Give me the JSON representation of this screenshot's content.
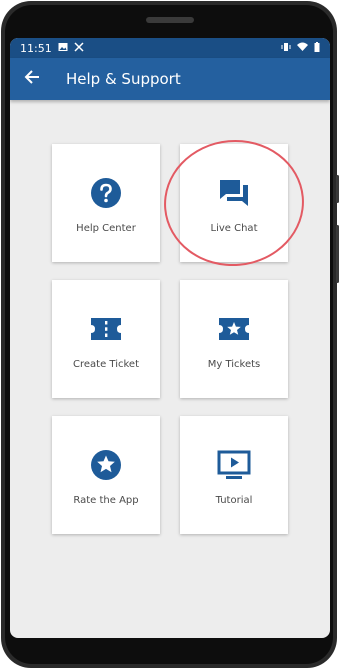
{
  "status_bar": {
    "time": "11:51",
    "left_icons": [
      "image-icon",
      "cut-icon"
    ],
    "right_icons": [
      "vibrate-icon",
      "wifi-icon",
      "battery-icon"
    ]
  },
  "app_bar": {
    "title": "Help & Support",
    "back_icon": "arrow-left-icon"
  },
  "menu": [
    {
      "label": "Help Center",
      "icon": "help-circle-icon"
    },
    {
      "label": "Live Chat",
      "icon": "chat-icon",
      "highlighted": true
    },
    {
      "label": "Create Ticket",
      "icon": "ticket-icon"
    },
    {
      "label": "My Tickets",
      "icon": "star-ticket-icon"
    },
    {
      "label": "Rate the App",
      "icon": "star-circle-icon"
    },
    {
      "label": "Tutorial",
      "icon": "play-screen-icon"
    }
  ],
  "colors": {
    "app_bar": "#24609f",
    "status_bar": "#1a4e85",
    "icon": "#1e5b99",
    "highlight": "#e35a63"
  }
}
